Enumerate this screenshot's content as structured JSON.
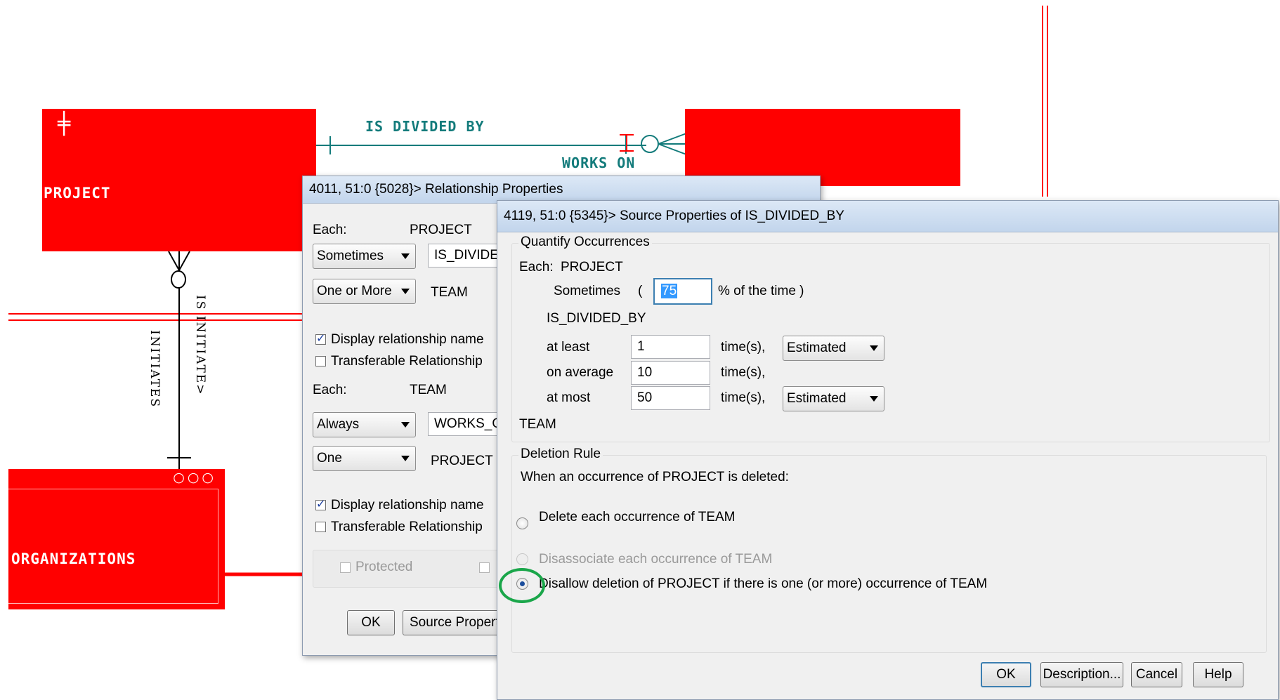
{
  "diagram": {
    "entities": {
      "project": "PROJECT",
      "organizations": "ORGANIZATIONS"
    },
    "relationships": {
      "is_divided_by": "IS DIVIDED BY",
      "works_on": "WORKS ON",
      "initiates": "INITIATES",
      "is_initiated": "IS INITIATE>"
    }
  },
  "relationship_dialog": {
    "title": "4011, 51:0 {5028}> Relationship Properties",
    "each_label_1": "Each:",
    "each_entity_1": "PROJECT",
    "optionality_1": "Sometimes",
    "name_1": "IS_DIVIDED_BY",
    "cardinality_1": "One or More",
    "target_1": "TEAM",
    "display_name_label_1": "Display relationship name",
    "display_name_checked_1": true,
    "transferable_label_1": "Transferable Relationship",
    "transferable_checked_1": false,
    "each_label_2": "Each:",
    "each_entity_2": "TEAM",
    "optionality_2": "Always",
    "name_2": "WORKS_ON",
    "cardinality_2": "One",
    "target_2": "PROJECT",
    "display_name_label_2": "Display relationship name",
    "display_name_checked_2": true,
    "transferable_label_2": "Transferable Relationship",
    "transferable_checked_2": false,
    "protected_label": "Protected",
    "ok_label": "OK",
    "source_properties_label": "Source Properties..."
  },
  "source_dialog": {
    "title": "4119, 51:0 {5345}> Source Properties of IS_DIVIDED_BY",
    "quantify_group": "Quantify Occurrences",
    "each_label": "Each:",
    "each_entity": "PROJECT",
    "sometimes_label": "Sometimes",
    "open_paren": "(",
    "percent_value": "75",
    "percent_suffix": "% of the time )",
    "relationship_name": "IS_DIVIDED_BY",
    "at_least_label": "at least",
    "at_least_value": "1",
    "on_average_label": "on average",
    "on_average_value": "10",
    "at_most_label": "at most",
    "at_most_value": "50",
    "times_label": "time(s),",
    "at_least_mode": "Estimated",
    "at_most_mode": "Estimated",
    "target_entity": "TEAM",
    "deletion_group": "Deletion Rule",
    "deletion_prompt": "When an occurrence of PROJECT is deleted:",
    "option_delete": "Delete each occurrence of TEAM",
    "option_disassociate": "Disassociate each occurrence of TEAM",
    "option_disallow": "Disallow deletion of PROJECT if there is one (or more) occurrence of TEAM",
    "selected_option": "disallow",
    "ok_label": "OK",
    "description_label": "Description...",
    "cancel_label": "Cancel",
    "help_label": "Help"
  },
  "colors": {
    "entity_fill": "#ff0000",
    "relationship_text": "#137b7b",
    "highlight_circle": "#1aa64a"
  }
}
